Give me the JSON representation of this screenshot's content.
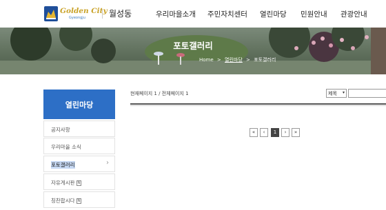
{
  "header": {
    "logo_text": "Golden City",
    "logo_sub": "Gyeongju",
    "site_name": "월성동",
    "nav": [
      "우리마을소개",
      "주민자치센터",
      "열린마당",
      "민원안내",
      "관광안내"
    ]
  },
  "banner": {
    "title": "포토갤러리",
    "breadcrumb": [
      "Home",
      ">",
      "열린마당",
      ">",
      "포토갤러리"
    ]
  },
  "sidebar": {
    "title": "열린마당",
    "items": [
      {
        "label": "공지사항"
      },
      {
        "label": "우리마을 소식"
      },
      {
        "label": "포토갤러리"
      },
      {
        "label": "자유게시판",
        "badge": "N"
      },
      {
        "label": "칭찬합시다",
        "badge": "N"
      }
    ]
  },
  "content": {
    "page_info": "현재페이지 1 / 전체페이지 1",
    "search_select": "제목",
    "pagination": [
      "«",
      "‹",
      "1",
      "›",
      "»"
    ]
  },
  "colors": {
    "accent": "#2d6fc6",
    "logo_gold": "#c9a227",
    "selected_highlight": "#c6d8f3"
  }
}
